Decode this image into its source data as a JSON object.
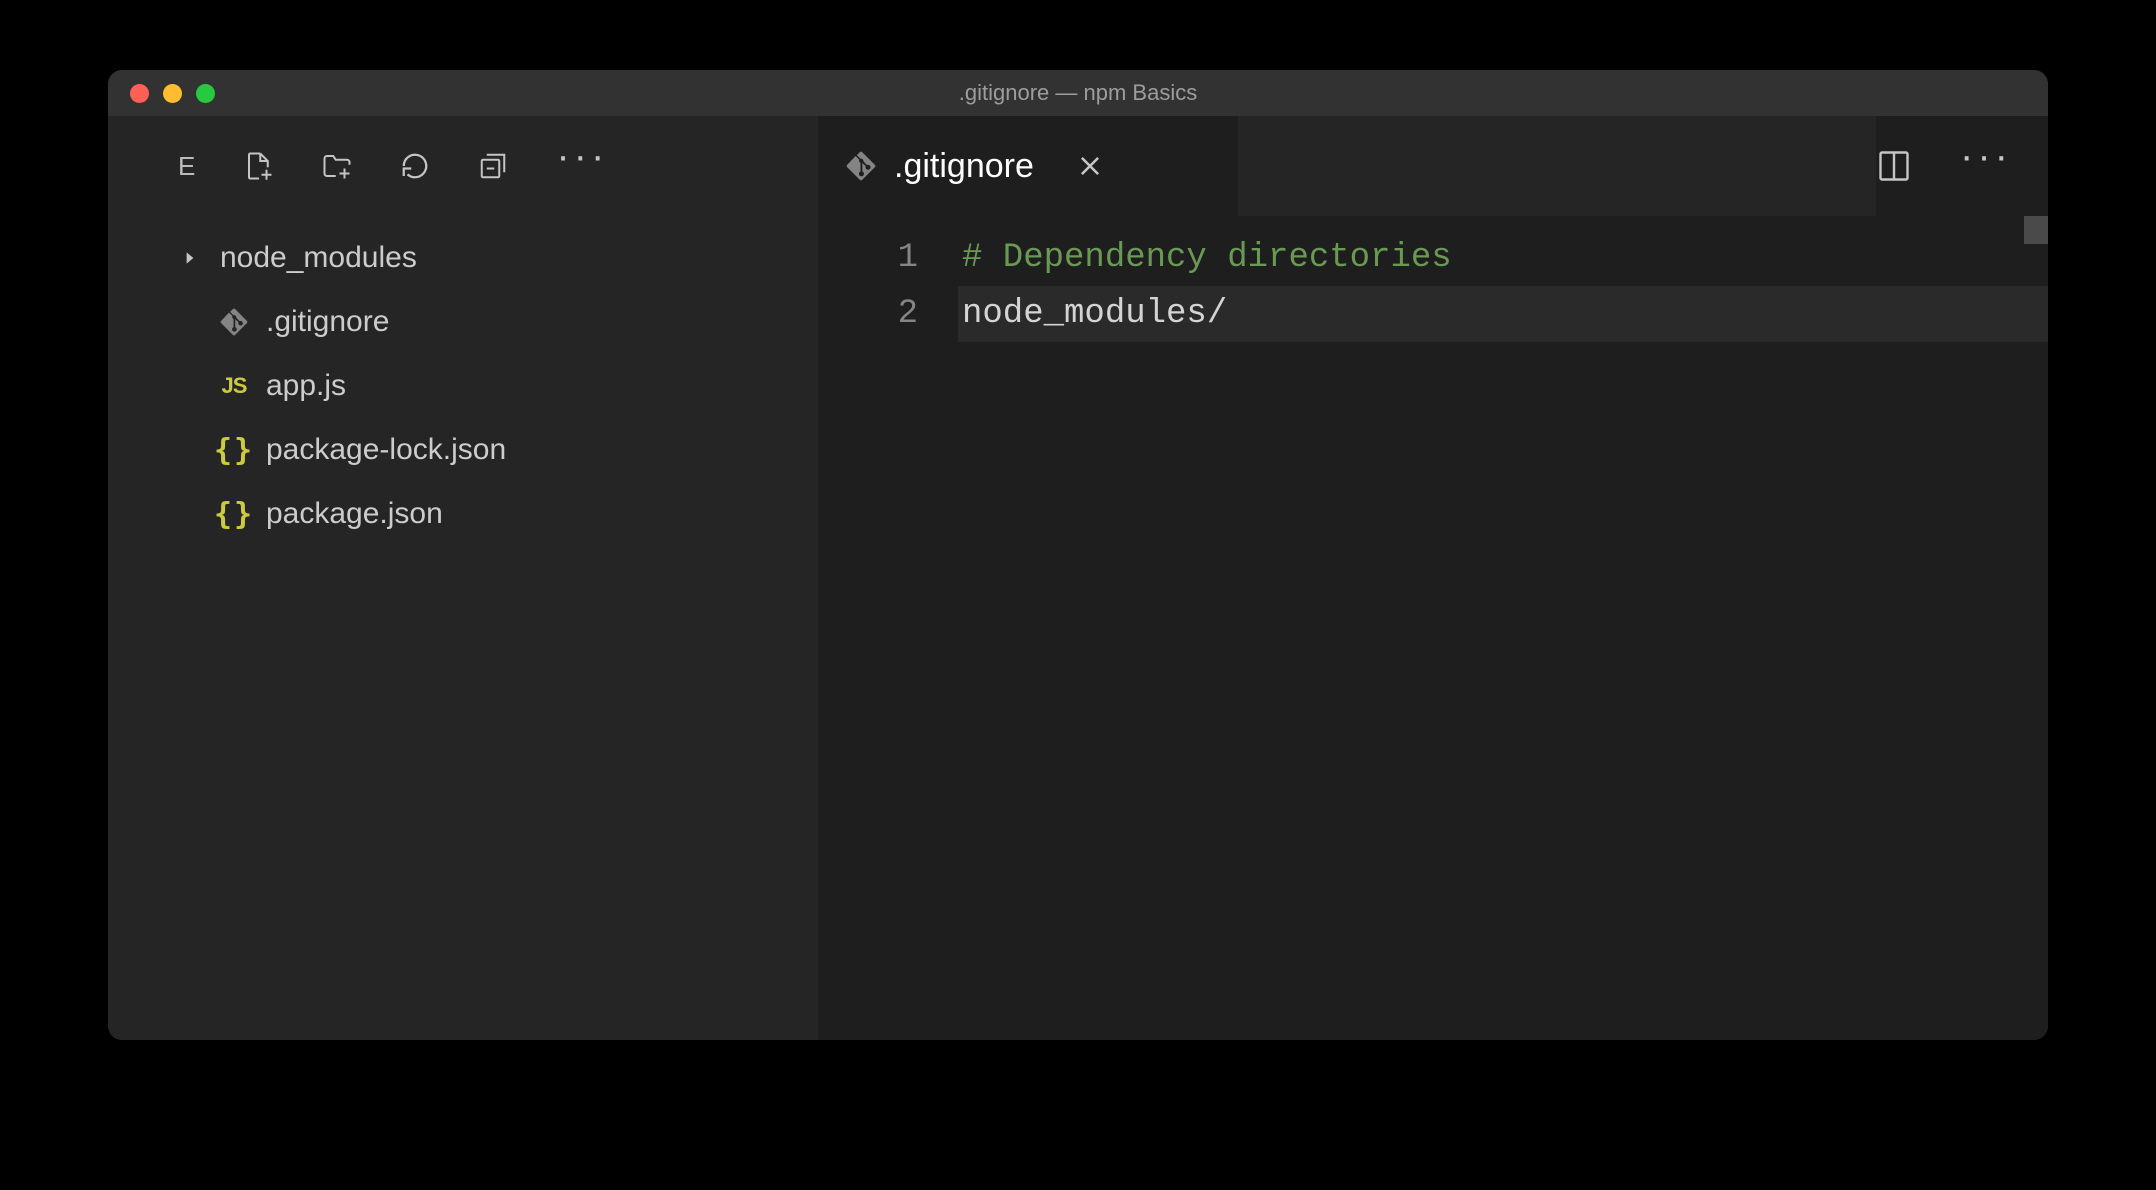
{
  "window": {
    "title": ".gitignore — npm Basics"
  },
  "sidebar": {
    "header_label": "E",
    "files": [
      {
        "name": "node_modules",
        "type": "folder"
      },
      {
        "name": ".gitignore",
        "type": "git",
        "active": true
      },
      {
        "name": "app.js",
        "type": "js"
      },
      {
        "name": "package-lock.json",
        "type": "json"
      },
      {
        "name": "package.json",
        "type": "json"
      }
    ]
  },
  "tabs": {
    "active": {
      "label": ".gitignore"
    }
  },
  "editor": {
    "lines": [
      {
        "num": "1",
        "text": "# Dependency directories",
        "class": "c-comment",
        "current": false
      },
      {
        "num": "2",
        "text": "node_modules/",
        "class": "c-text",
        "current": true
      }
    ]
  }
}
